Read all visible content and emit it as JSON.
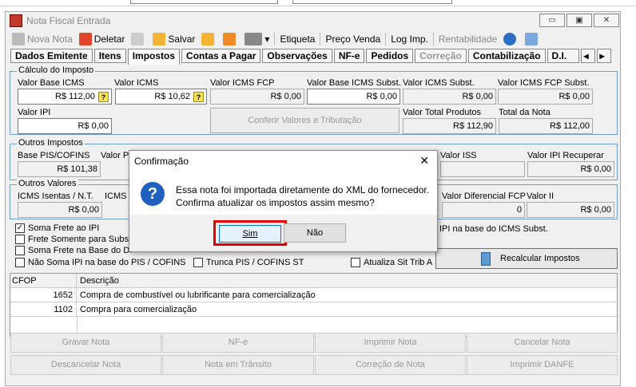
{
  "window": {
    "title": "Nota Fiscal Entrada",
    "btn_min": "▭",
    "btn_max": "▣",
    "btn_close": "✕"
  },
  "toolbar": {
    "novo": "Nova Nota",
    "deletar": "Deletar",
    "salvar": "Salvar",
    "etiqueta": "Etiqueta",
    "preco": "Preço Venda",
    "log": "Log Imp.",
    "rent": "Rentabilidade"
  },
  "tabs": [
    "Dados Emitente",
    "Itens",
    "Impostos",
    "Contas a Pagar",
    "Observações",
    "NF-e",
    "Pedidos",
    "Correção",
    "Contabilização",
    "D.I."
  ],
  "calc": {
    "title": "Cálculo do Imposto",
    "l_base_icms": "Valor Base ICMS",
    "v_base_icms": "R$ 112,00",
    "l_icms": "Valor ICMS",
    "v_icms": "R$ 10,62",
    "l_icms_fcp": "Valor ICMS FCP",
    "v_icms_fcp": "R$ 0,00",
    "l_base_subst": "Valor Base ICMS Subst.",
    "v_base_subst": "R$ 0,00",
    "l_icms_subst": "Valor ICMS Subst.",
    "v_icms_subst": "R$ 0,00",
    "l_fcp_subst": "Valor ICMS FCP Subst.",
    "v_fcp_subst": "R$ 0,00",
    "l_ipi": "Valor IPI",
    "v_ipi": "R$ 0,00",
    "conferir": "Conferir Valores e Tributação",
    "l_total_prod": "Valor Total Produtos",
    "v_total_prod": "R$ 112,90",
    "l_total_nota": "Total da Nota",
    "v_total_nota": "R$ 112,00"
  },
  "outros_imp": {
    "title": "Outros Impostos",
    "l_base_pis": "Base PIS/COFINS",
    "v_base_pis": "R$ 101,38",
    "l_valor_p": "Valor P",
    "l_iss": "Valor ISS",
    "l_ipi_rec": "Valor IPI Recuperar",
    "v_ipi_rec": "R$ 0,00"
  },
  "outros_val": {
    "title": "Outros Valores",
    "l_isentas": "ICMS Isentas / N.T.",
    "v_isentas": "R$ 0,00",
    "l_icms_c": "ICMS C",
    "l_dif_fcp": "Valor Diferencial FCP",
    "v_dif_fcp": "0",
    "l_ii": "Valor II",
    "v_ii": "R$ 0,00"
  },
  "checks": {
    "soma_frete_ipi": "Soma Frete ao IPI",
    "frete_subst": "Frete Somente para Substi",
    "soma_frete_base": "Soma Frete na Base do Di",
    "nao_soma_ipi": "Não Soma IPI na base do PIS / COFINS",
    "trunca": "Trunca PIS / COFINS ST",
    "atualiza": "Atualiza Sit Trib A",
    "ipi_base_icms": "IPI na base do ICMS Subst."
  },
  "recalcular": "Recalcular Impostos",
  "grid": {
    "h_cfop": "CFOP",
    "h_desc": "Descrição",
    "rows": [
      {
        "cfop": "1652",
        "desc": "Compra de combustível ou lubrificante para comercialização"
      },
      {
        "cfop": "1102",
        "desc": "Compra para comercialização"
      }
    ]
  },
  "bottom": [
    "Gravar Nota",
    "NF-e",
    "Imprimir Nota",
    "Cancelar Nota",
    "Descancelar Nota",
    "Nota em Trânsito",
    "Correção de Nota",
    "Imprimir DANFE"
  ],
  "dialog": {
    "title": "Confirmação",
    "close": "✕",
    "line1": "Essa nota foi importada diretamente do XML do fornecedor.",
    "line2": "Confirma atualizar os impostos assim mesmo?",
    "sim": "Sim",
    "nao": "Não",
    "icon": "question-icon"
  },
  "colors": {
    "group_border": "#6f9fd0",
    "highlight": "#e00000"
  }
}
